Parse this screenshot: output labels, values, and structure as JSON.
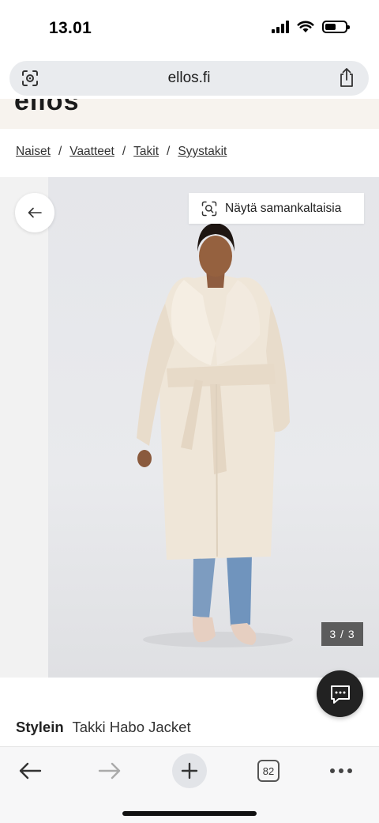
{
  "status_bar": {
    "time": "13.01",
    "battery_level": 0.55
  },
  "browser": {
    "url": "ellos.fi",
    "tab_count": "82"
  },
  "site": {
    "logo": "ellos"
  },
  "breadcrumb": [
    {
      "label": "Naiset"
    },
    {
      "label": "Vaatteet"
    },
    {
      "label": "Takit"
    },
    {
      "label": "Syystakit"
    }
  ],
  "breadcrumb_separator": "/",
  "gallery": {
    "similar_label": "Näytä samankaltaisia",
    "counter": "3 / 3"
  },
  "product": {
    "brand": "Stylein",
    "name": "Takki Habo Jacket"
  },
  "colors": {
    "header_bg": "#f7f3ee",
    "coat": "#efe6d8",
    "jeans": "#7d9cc0",
    "counter_bg": "#5c5c5c",
    "fab_bg": "#222222"
  }
}
